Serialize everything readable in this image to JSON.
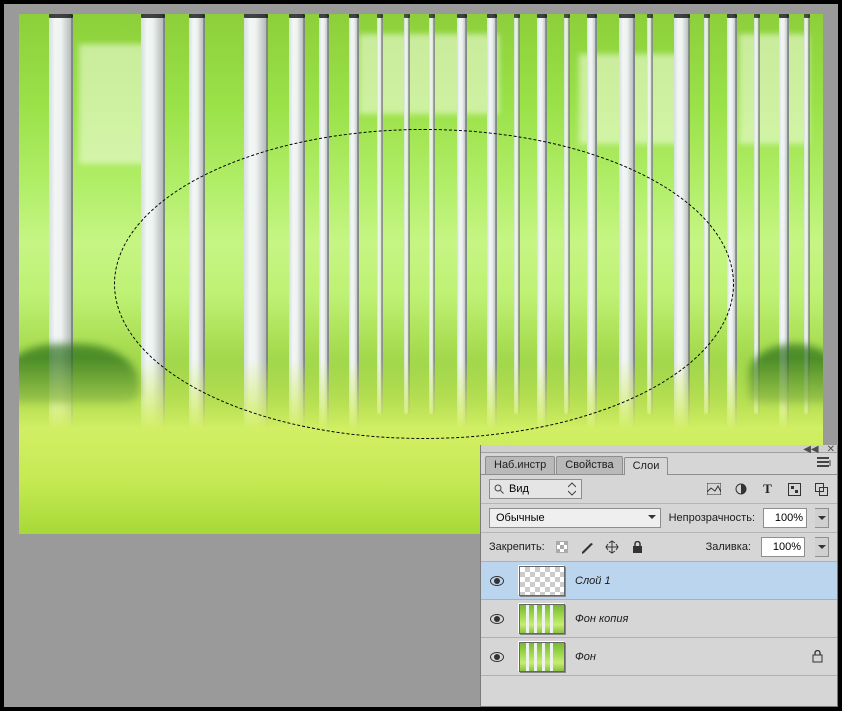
{
  "panel": {
    "tabs": [
      "Наб.инстр",
      "Свойства",
      "Слои"
    ],
    "active_tab": 2,
    "filter_label": "Вид",
    "blend_mode": "Обычные",
    "opacity_label": "Непрозрачность:",
    "opacity_value": "100%",
    "lock_label": "Закрепить:",
    "fill_label": "Заливка:",
    "fill_value": "100%"
  },
  "layers": [
    {
      "name": "Слой 1",
      "visible": true,
      "locked": false,
      "thumb": "transparent",
      "selected": true
    },
    {
      "name": "Фон копия",
      "visible": true,
      "locked": false,
      "thumb": "image",
      "selected": false
    },
    {
      "name": "Фон",
      "visible": true,
      "locked": true,
      "thumb": "image",
      "selected": false
    }
  ]
}
